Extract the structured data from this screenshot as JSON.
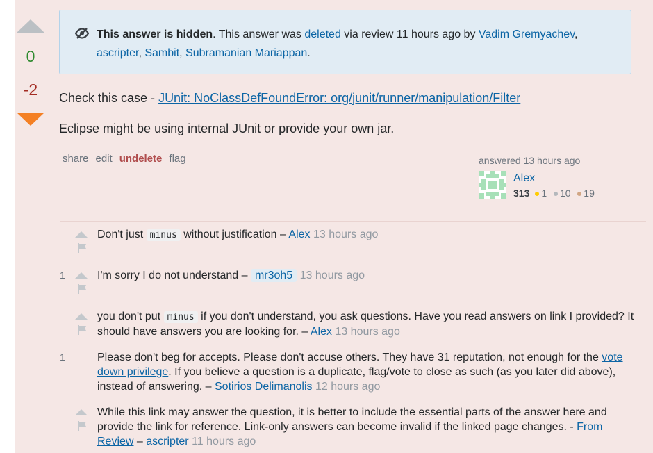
{
  "vote": {
    "up_count": "0",
    "down_count": "-2"
  },
  "notice": {
    "title": "This answer is hidden",
    "text1": ". This answer was ",
    "deleted_link": "deleted",
    "text2": " via review 11 hours ago by ",
    "users": [
      "Vadim Gremyachev",
      "ascripter",
      "Sambit",
      "Subramanian Mariappan"
    ]
  },
  "answer": {
    "p1_prefix": "Check this case - ",
    "p1_link": "JUnit: NoClassDefFoundError: org/junit/runner/manipulation/Filter",
    "p2": "Eclipse might be using internal JUnit or provide your own jar."
  },
  "menu": {
    "share": "share",
    "edit": "edit",
    "undelete": "undelete",
    "flag": "flag"
  },
  "signature": {
    "answered": "answered 13 hours ago",
    "name": "Alex",
    "rep": "313",
    "gold": "1",
    "silver": "10",
    "bronze": "19",
    "badge_colors": {
      "gold": "#ffcc01",
      "silver": "#b4b8bc",
      "bronze": "#d1a684"
    }
  },
  "comments": [
    {
      "score": "",
      "pre": "Don't just ",
      "code": "minus",
      "post": " without justification – ",
      "user": "Alex",
      "date": "13 hours ago"
    },
    {
      "score": "1",
      "text": "I'm sorry I do not understand – ",
      "user": "mr3oh5",
      "date": "13 hours ago"
    },
    {
      "score": "",
      "pre": "you don't put ",
      "code": "minus",
      "post": " if you don't understand, you ask questions. Have you read answers on link I provided? It should have answers you are looking for. – ",
      "user": "Alex",
      "date": "13 hours ago"
    },
    {
      "score": "1",
      "text1": "Please don't beg for accepts. Please don't accuse others. They have 31 reputation, not enough for the ",
      "link": "vote down privilege",
      "text2": ". If you believe a question is a duplicate, flag/vote to close as such (as you later did above), instead of answering. – ",
      "user": "Sotirios Delimanolis",
      "date": "12 hours ago"
    },
    {
      "score": "",
      "text1": "While this link may answer the question, it is better to include the essential parts of the answer here and provide the link for reference. Link-only answers can become invalid if the linked page changes. - ",
      "link": "From Review",
      "text2": " – ",
      "user": "ascripter",
      "date": "11 hours ago"
    }
  ]
}
